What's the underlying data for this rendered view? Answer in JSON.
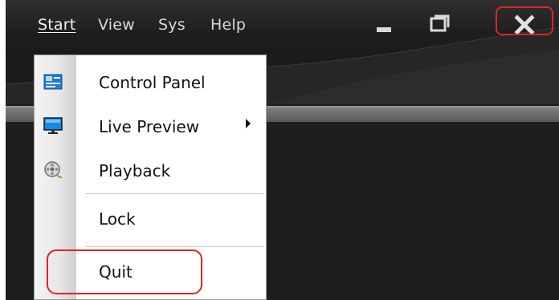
{
  "menubar": {
    "items": [
      {
        "label": "Start"
      },
      {
        "label": "View"
      },
      {
        "label": "Sys"
      },
      {
        "label": "Help"
      }
    ]
  },
  "window_controls": {
    "minimize_icon": "minimize-icon",
    "restore_icon": "restore-icon",
    "close_icon": "close-icon"
  },
  "dropdown": {
    "items": [
      {
        "label": "Control Panel",
        "icon": "control-panel-icon"
      },
      {
        "label": "Live Preview",
        "icon": "monitor-icon",
        "has_submenu": true
      },
      {
        "label": "Playback",
        "icon": "playback-icon"
      },
      {
        "label": "Lock"
      },
      {
        "label": "Quit"
      }
    ]
  },
  "highlight_color": "#e02424"
}
